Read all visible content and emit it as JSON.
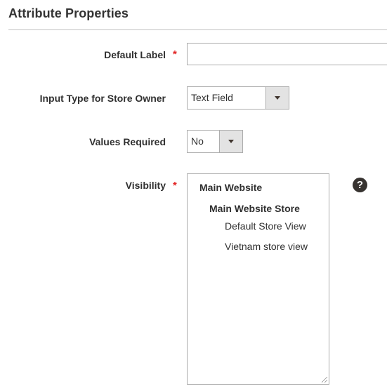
{
  "section": {
    "title": "Attribute Properties"
  },
  "fields": {
    "default_label": {
      "label": "Default Label",
      "required_mark": "*",
      "value": ""
    },
    "input_type": {
      "label": "Input Type for Store Owner",
      "selected": "Text Field"
    },
    "values_required": {
      "label": "Values Required",
      "selected": "No"
    },
    "visibility": {
      "label": "Visibility",
      "required_mark": "*",
      "options": {
        "website": "Main Website",
        "store": "Main Website Store",
        "views": [
          "Default Store View",
          "Vietnam store view"
        ]
      },
      "help_icon": "question-circle-icon",
      "help_glyph": "?"
    }
  },
  "colors": {
    "required": "#e22626",
    "border": "#adadad",
    "select_arrow_bg": "#e3e3e3",
    "help_icon_bg": "#373330"
  }
}
